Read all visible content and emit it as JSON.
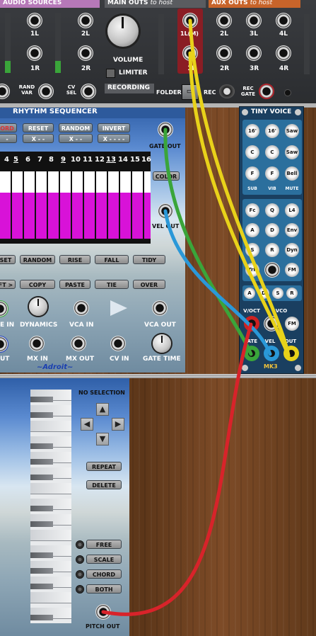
{
  "audio_module": {
    "sources_title": "AUDIO SOURCES",
    "main_outs_title": "MAIN OUTS",
    "main_outs_sub": "to host",
    "aux_outs_title": "AUX OUTS",
    "aux_outs_sub": "to host",
    "src_jacks": [
      "1L",
      "2L",
      "1R",
      "2R"
    ],
    "volume_label": "VOLUME",
    "limiter_label": "LIMITER",
    "main_jacks": [
      "1L(M)",
      "1R"
    ],
    "aux_jacks_top": [
      "2L",
      "3L",
      "4L"
    ],
    "aux_jacks_bottom": [
      "2R",
      "3R",
      "4R"
    ],
    "rand_var": "RAND VAR",
    "cv_sel": "CV SEL",
    "recording_label": "RECORDING",
    "folder_label": "FOLDER",
    "rec_label": "REC",
    "rec_gate_label": "REC GATE"
  },
  "rhythm": {
    "title": "RHYTHM SEQUENCER",
    "top_buttons": [
      "ORD",
      "RESET",
      "RANDOM",
      "INVERT"
    ],
    "top_values": [
      "-",
      "X - -",
      "X - -",
      "X - - - -"
    ],
    "gate_out": "GATE OUT",
    "color": "COLOR",
    "vel_out": "VEL OUT",
    "steps": [
      "4",
      "5",
      "6",
      "7",
      "8",
      "9",
      "10",
      "11",
      "12",
      "13",
      "14",
      "15",
      "16"
    ],
    "underlined_steps": [
      "5",
      "9",
      "13"
    ],
    "mid_buttons": [
      "SET",
      "RANDOM",
      "RISE",
      "FALL",
      "TIDY"
    ],
    "low_buttons": [
      "FT >",
      "COPY",
      "PASTE",
      "TIE",
      "OVER"
    ],
    "dynamics": "DYNAMICS",
    "gate_in": "E IN",
    "vca_in": "VCA IN",
    "vca_out": "VCA OUT",
    "out_left": "UT",
    "mx_in": "MX IN",
    "mx_out": "MX OUT",
    "cv_in": "CV IN",
    "gate_time": "GATE TIME",
    "brand": "~Adroit~"
  },
  "tiny_voice": {
    "title": "TINY VOICE",
    "row1": [
      "16'",
      "16'",
      "Saw"
    ],
    "row2": [
      "C",
      "C",
      "Saw"
    ],
    "row3": [
      "F",
      "F",
      "Bell"
    ],
    "row_labels": [
      "SUB",
      "VIB",
      "MUTE"
    ],
    "row4": [
      "Fc",
      "Q",
      "L4"
    ],
    "row5": [
      "A",
      "D",
      "Env"
    ],
    "row6": [
      "S",
      "R",
      "Dyn"
    ],
    "row7": [
      "Trk",
      "",
      "FM"
    ],
    "adsr": [
      "A",
      "D",
      "S",
      "R"
    ],
    "voct": "V/OCT",
    "vco": "VCO",
    "fm": "FM",
    "gate": "GATE",
    "vel": "VEL",
    "out": "OUT",
    "brand": "MK3"
  },
  "pitch_seq": {
    "status": "NO SELECTION",
    "repeat": "REPEAT",
    "delete": "DELETE",
    "modes": [
      "FREE",
      "SCALE",
      "CHORD",
      "BOTH"
    ],
    "pitch_out": "PITCH OUT"
  },
  "cables": {
    "yellow": "#e8d21a",
    "green": "#3aa53a",
    "blue": "#2a98d8",
    "red": "#d8232a"
  }
}
